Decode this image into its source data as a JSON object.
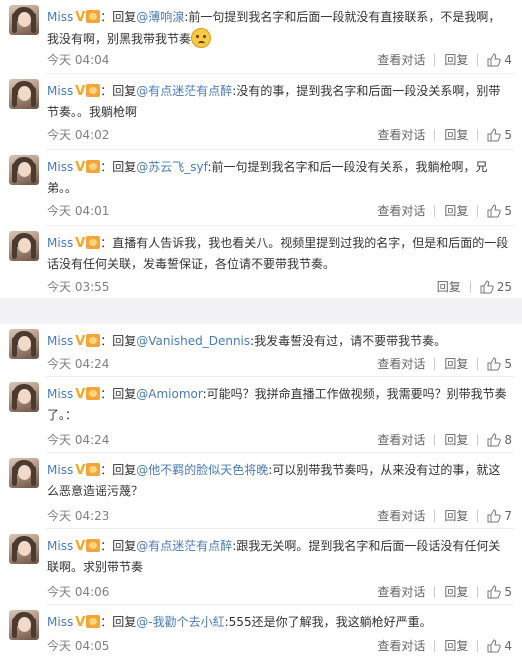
{
  "labels": {
    "view_dialog": "查看对话",
    "reply": "回复"
  },
  "block_a": [
    {
      "name": "Miss",
      "prefix": "：回复",
      "mention": "@薄响湶",
      "body": ":前一句提到我名字和后面一段就没有直接联系，不是我啊，我没有啊，别黑我带我节奏",
      "emoji": "sad-face",
      "time": "今天 04:04",
      "has_dialog": true,
      "likes": "4"
    },
    {
      "name": "Miss",
      "prefix": "：回复",
      "mention": "@有点迷茫有点醉",
      "body": ":没有的事，提到我名字和后面一段没关系啊，别带节奏。。我躺枪啊",
      "time": "今天 04:02",
      "has_dialog": true,
      "likes": "5"
    },
    {
      "name": "Miss",
      "prefix": "：回复",
      "mention": "@苏云飞_syf",
      "body": ":前一句提到我名字和后一段没有关系，我躺枪啊，兄弟。。",
      "time": "今天 04:01",
      "has_dialog": true,
      "likes": "5"
    },
    {
      "name": "Miss",
      "prefix": "：",
      "mention": "",
      "body": "直播有人告诉我，我也看关八。视频里提到过我的名字，但是和后面的一段话没有任何关联，发毒誓保证，各位请不要带我节奏。",
      "time": "今天 03:55",
      "has_dialog": false,
      "likes": "25"
    }
  ],
  "block_b": [
    {
      "name": "Miss",
      "prefix": "：回复",
      "mention": "@Vanished_Dennis",
      "body": ":我发毒誓没有过，请不要带我节奏。",
      "time": "今天 04:24",
      "has_dialog": true,
      "likes": "5"
    },
    {
      "name": "Miss",
      "prefix": "：回复",
      "mention": "@Amiomor",
      "body": ":可能吗？我拼命直播工作做视频，我需要吗？别带我节奏了。：",
      "time": "今天 04:24",
      "has_dialog": true,
      "likes": "8"
    },
    {
      "name": "Miss",
      "prefix": "：回复",
      "mention": "@他不羁的脸似天色将晚",
      "body": ":可以别带我节奏吗，从来没有过的事，就这么恶意造谣污蔑？",
      "time": "今天 04:23",
      "has_dialog": true,
      "likes": "7"
    },
    {
      "name": "Miss",
      "prefix": "：回复",
      "mention": "@有点迷茫有点醉",
      "body": ":跟我无关啊。提到我名字和后面一段话没有任何关联啊。求别带节奏",
      "time": "今天 04:06",
      "has_dialog": true,
      "likes": "5"
    },
    {
      "name": "Miss",
      "prefix": "：回复",
      "mention": "@-我勸个去小紅",
      "body": ":555还是你了解我，我这躺枪好严重。",
      "time": "今天 04:05",
      "has_dialog": true,
      "likes": "4"
    }
  ],
  "colors": {
    "link": "#4a7bb7",
    "meta": "#808080",
    "gap": "#f2f2f5"
  }
}
